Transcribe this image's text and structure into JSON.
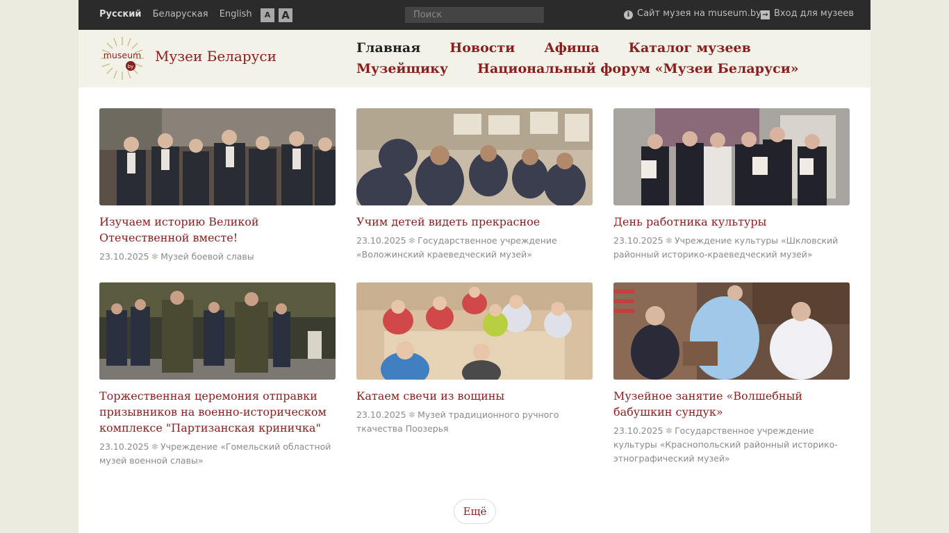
{
  "topbar": {
    "languages": [
      {
        "label": "Русский",
        "active": true
      },
      {
        "label": "Беларуская",
        "active": false
      },
      {
        "label": "English",
        "active": false
      }
    ],
    "font_small": "A",
    "font_large": "A",
    "search_placeholder": "Поиск",
    "site_link": "Сайт музея на museum.by",
    "login_link": "Вход для музеев"
  },
  "header": {
    "site_title": "Музеи Беларуси",
    "logo": {
      "top_text": "museum",
      "bottom_text": "by"
    },
    "nav": [
      {
        "label": "Главная",
        "current": true
      },
      {
        "label": "Новости",
        "current": false
      },
      {
        "label": "Афиша",
        "current": false
      },
      {
        "label": "Каталог музеев",
        "current": false
      },
      {
        "label": "Музейщику",
        "current": false
      },
      {
        "label": "Национальный форум «Музеи Беларуси»",
        "current": false
      }
    ]
  },
  "colors": {
    "accent": "#8a1e1e",
    "topbar": "#2b2b2b",
    "header": "#f2f2e8",
    "meta": "#8a8a8a"
  },
  "news": [
    {
      "title": "Изучаем историю Великой Отечественной вместе!",
      "date": "23.10.2025",
      "museum": "Музей боевой славы"
    },
    {
      "title": "Учим детей видеть прекрасное",
      "date": "23.10.2025",
      "museum": "Государственное учреждение «Воложинский краеведческий музей»"
    },
    {
      "title": "День работника культуры",
      "date": "23.10.2025",
      "museum": "Учреждение культуры «Шкловский районный историко-краеведческий музей»"
    },
    {
      "title": "Торжественная церемония отправки призывников на военно-историческом комплексе \"Партизанская криничка\"",
      "date": "23.10.2025",
      "museum": "Учреждение «Гомельский областной музей военной славы»"
    },
    {
      "title": "Катаем свечи из вощины",
      "date": "23.10.2025",
      "museum": "Музей традиционного ручного ткачества Поозерья"
    },
    {
      "title": "Музейное занятие «Волшебный бабушкин сундук»",
      "date": "23.10.2025",
      "museum": "Государственное учреждение культуры «Краснопольский районный историко-этнографический музей»"
    }
  ],
  "more_label": "Ещё"
}
